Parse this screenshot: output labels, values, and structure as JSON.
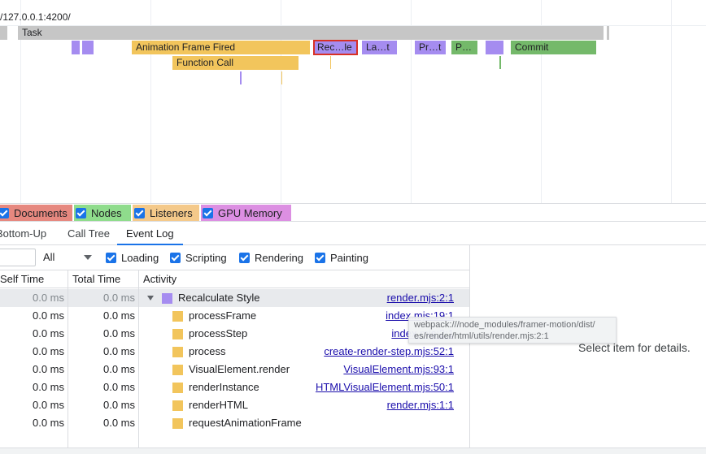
{
  "flame": {
    "url": "/127.0.0.1:4200/",
    "task_label": "Task",
    "animation_frame_label": "Animation Frame Fired",
    "recalc_label": "Rec…le",
    "layout_label": "La…t",
    "pre_paint_label": "Pr…t",
    "paint_label": "P…",
    "commit_label": "Commit",
    "function_call_label": "Function Call"
  },
  "counters": {
    "documents": "Documents",
    "nodes": "Nodes",
    "listeners": "Listeners",
    "gpu_memory": "GPU Memory",
    "colors": {
      "documents": "#e6887f",
      "nodes": "#8fdc8c",
      "listeners": "#f4c98a",
      "gpu_memory": "#dc8fe2"
    }
  },
  "tabs": {
    "bottom_up": "Bottom-Up",
    "call_tree": "Call Tree",
    "event_log": "Event Log"
  },
  "filters": {
    "select_value": "All",
    "loading": "Loading",
    "scripting": "Scripting",
    "rendering": "Rendering",
    "painting": "Painting"
  },
  "table": {
    "headers": {
      "self_time": "Self Time",
      "total_time": "Total Time",
      "activity": "Activity"
    },
    "rows": [
      {
        "self": "0.0 ms",
        "total": "0.0 ms",
        "name": "Recalculate Style",
        "link": "render.mjs:2:1",
        "color": "#a58cf0"
      },
      {
        "self": "0.0 ms",
        "total": "0.0 ms",
        "name": "processFrame",
        "link": "index.mjs:19:1",
        "color": "#f2c55c"
      },
      {
        "self": "0.0 ms",
        "total": "0.0 ms",
        "name": "processStep",
        "link": "index.mjs:2:1",
        "color": "#f2c55c"
      },
      {
        "self": "0.0 ms",
        "total": "0.0 ms",
        "name": "process",
        "link": "create-render-step.mjs:52:1",
        "color": "#f2c55c"
      },
      {
        "self": "0.0 ms",
        "total": "0.0 ms",
        "name": "VisualElement.render",
        "link": "VisualElement.mjs:93:1",
        "color": "#f2c55c"
      },
      {
        "self": "0.0 ms",
        "total": "0.0 ms",
        "name": "renderInstance",
        "link": "HTMLVisualElement.mjs:50:1",
        "color": "#f2c55c"
      },
      {
        "self": "0.0 ms",
        "total": "0.0 ms",
        "name": "renderHTML",
        "link": "render.mjs:1:1",
        "color": "#f2c55c"
      },
      {
        "self": "0.0 ms",
        "total": "0.0 ms",
        "name": "requestAnimationFrame",
        "link": "",
        "color": "#f2c55c"
      }
    ]
  },
  "tooltip": {
    "line1": "webpack:///node_modules/framer-motion/dist/",
    "line2": "es/render/html/utils/render.mjs:2:1"
  },
  "details": {
    "placeholder": "Select item for details."
  }
}
